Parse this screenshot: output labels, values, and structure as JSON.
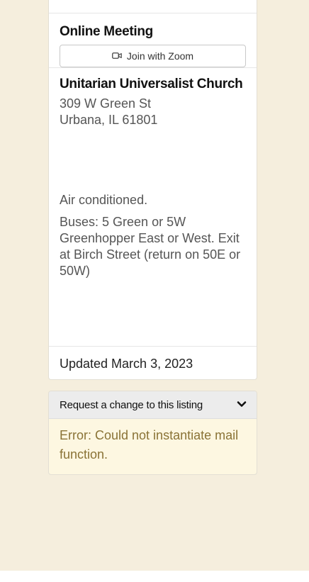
{
  "meeting": {
    "heading": "Online Meeting",
    "join_label": "Join with Zoom",
    "join_icon": "video-camera-icon"
  },
  "location": {
    "name": "Unitarian Universalist Church",
    "address_line1": "309 W Green St",
    "address_line2": "Urbana, IL 61801",
    "notes": [
      "Air conditioned.",
      "Buses: 5 Green or 5W Greenhopper East or West. Exit at Birch Street (return on 50E or 50W)"
    ]
  },
  "updated": "Updated March 3, 2023",
  "change_request": {
    "label": "Request a change to this listing",
    "toggle_icon": "chevron-down-icon",
    "error": "Error: Could not instantiate mail function."
  },
  "colors": {
    "page_background": "#f5eedd",
    "card_background": "#ffffff",
    "error_background": "#fdf7e1",
    "error_text": "#8a7336",
    "header_background": "#ececec"
  }
}
